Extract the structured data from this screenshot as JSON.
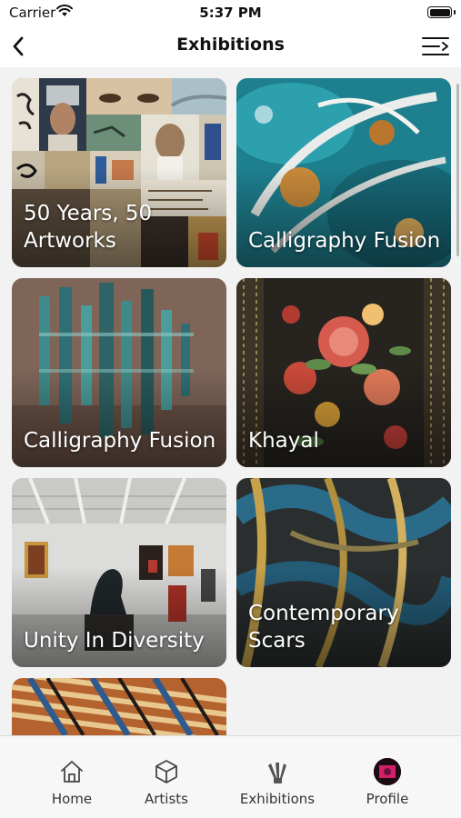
{
  "status_bar": {
    "carrier": "Carrier",
    "time": "5:37 PM"
  },
  "header": {
    "title": "Exhibitions"
  },
  "exhibitions": [
    {
      "title": "50 Years, 50 Artworks"
    },
    {
      "title": "Calligraphy Fusion"
    },
    {
      "title": "Calligraphy Fusion"
    },
    {
      "title": "Khayal"
    },
    {
      "title": "Unity In Diversity"
    },
    {
      "title": "Contemporary Scars"
    }
  ],
  "tab_bar": {
    "items": [
      {
        "label": "Home",
        "icon": "home-icon"
      },
      {
        "label": "Artists",
        "icon": "cube-icon"
      },
      {
        "label": "Exhibitions",
        "icon": "brushes-icon"
      },
      {
        "label": "Profile",
        "icon": "avatar"
      }
    ]
  },
  "colors": {
    "background": "#f2f2f2",
    "header": "#ffffff",
    "card_text": "#ffffff",
    "tab_text": "#333333"
  }
}
